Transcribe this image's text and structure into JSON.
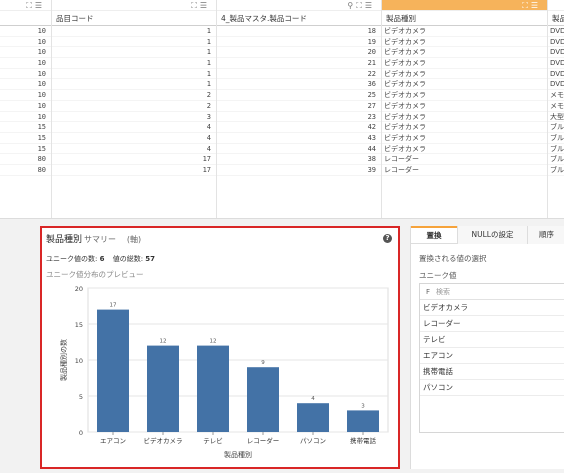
{
  "grid": {
    "columns": [
      {
        "header": ""
      },
      {
        "header": "品目コード"
      },
      {
        "header": "4_製品マスタ.製品コード"
      },
      {
        "header": "製品種別"
      },
      {
        "header": "製品"
      }
    ],
    "rows": [
      [
        "10",
        "1",
        "18",
        "ビデオカメラ",
        "DVD"
      ],
      [
        "10",
        "1",
        "19",
        "ビデオカメラ",
        "DVD"
      ],
      [
        "10",
        "1",
        "20",
        "ビデオカメラ",
        "DVD"
      ],
      [
        "10",
        "1",
        "21",
        "ビデオカメラ",
        "DVD"
      ],
      [
        "10",
        "1",
        "22",
        "ビデオカメラ",
        "DVD"
      ],
      [
        "10",
        "1",
        "36",
        "ビデオカメラ",
        "DVD"
      ],
      [
        "10",
        "2",
        "25",
        "ビデオカメラ",
        "メモ"
      ],
      [
        "10",
        "2",
        "27",
        "ビデオカメラ",
        "メモ"
      ],
      [
        "10",
        "3",
        "23",
        "ビデオカメラ",
        "大型"
      ],
      [
        "15",
        "4",
        "42",
        "ビデオカメラ",
        "ブル"
      ],
      [
        "15",
        "4",
        "43",
        "ビデオカメラ",
        "ブル"
      ],
      [
        "15",
        "4",
        "44",
        "ビデオカメラ",
        "ブル"
      ],
      [
        "80",
        "17",
        "38",
        "レコーダー",
        "ブル"
      ],
      [
        "80",
        "17",
        "39",
        "レコーダー",
        "ブル"
      ]
    ]
  },
  "profile": {
    "title": "製品種別",
    "summary_label": "サマリー",
    "axis_label": "(軸)",
    "help_icon": "question-icon",
    "unique_count_label": "ユニーク値の数:",
    "unique_count": "6",
    "total_count_label": "値の総数:",
    "total_count": "57",
    "preview_label": "ユニーク値分布のプレビュー"
  },
  "chart_data": {
    "type": "bar",
    "categories": [
      "エアコン",
      "ビデオカメラ",
      "テレビ",
      "レコーダー",
      "パソコン",
      "携帯電話"
    ],
    "values": [
      17,
      12,
      12,
      9,
      4,
      3
    ],
    "xlabel": "製品種別",
    "ylabel": "製品種別の数",
    "ylim": [
      0,
      20
    ],
    "yticks": [
      0,
      5,
      10,
      15,
      20
    ],
    "bar_color": "#4372a6",
    "grid": true
  },
  "right_panel": {
    "tabs": [
      "置換",
      "NULLの設定",
      "順序"
    ],
    "replace_title": "置換される値の選択",
    "unique_values_label": "ユニーク値",
    "search_prefix": "F",
    "search_placeholder": "検索",
    "items": [
      "ビデオカメラ",
      "レコーダー",
      "テレビ",
      "エアコン",
      "携帯電話",
      "パソコン"
    ],
    "accent_color": "#f6a33b"
  }
}
